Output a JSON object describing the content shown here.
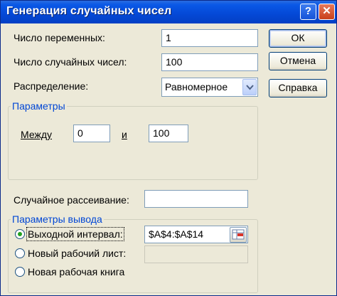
{
  "window": {
    "title": "Генерация случайных чисел",
    "help_glyph": "?",
    "close_glyph": "✕"
  },
  "form": {
    "num_variables_label": "Число переменных:",
    "num_variables_value": "1",
    "num_random_label": "Число случайных чисел:",
    "num_random_value": "100",
    "distribution_label": "Распределение:",
    "distribution_value": "Равномерное"
  },
  "buttons": {
    "ok": "ОК",
    "cancel": "Отмена",
    "help": "Справка"
  },
  "params": {
    "group_title": "Параметры",
    "between_label": "Между",
    "from_value": "0",
    "and_label": "и",
    "to_value": "100"
  },
  "seed": {
    "label": "Случайное рассеивание:",
    "value": ""
  },
  "output": {
    "group_title": "Параметры вывода",
    "options": [
      {
        "label": "Выходной интервал:",
        "selected": true
      },
      {
        "label": "Новый рабочий лист:",
        "selected": false
      },
      {
        "label": "Новая рабочая книга",
        "selected": false
      }
    ],
    "range_value": "$A$4:$A$14",
    "sheet_value": ""
  },
  "icons": {
    "help": "help-icon",
    "close": "close-icon",
    "dropdown": "chevron-down-icon",
    "range_picker": "range-picker-icon"
  }
}
